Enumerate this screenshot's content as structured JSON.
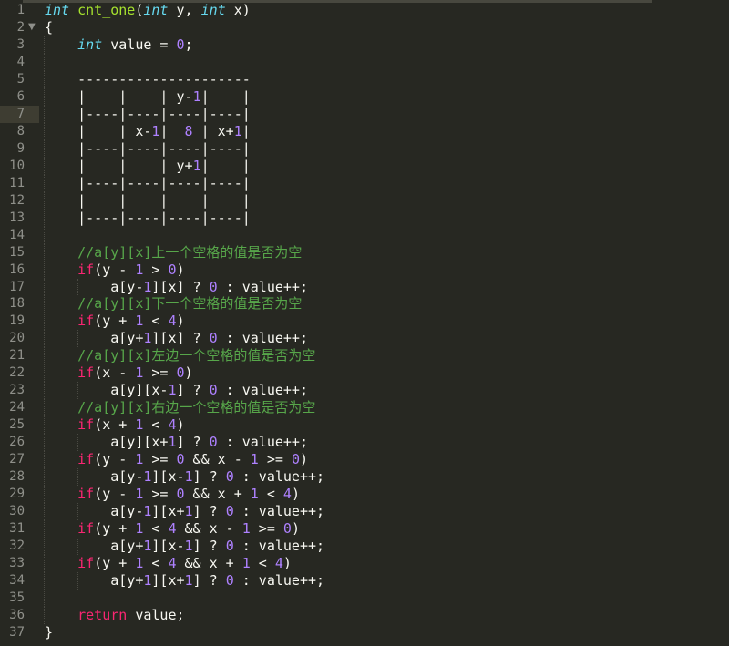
{
  "editor": {
    "theme_colors": {
      "background": "#272822",
      "type": "#66d9ef",
      "function": "#a6e22e",
      "keyword": "#f92672",
      "number": "#ae81ff",
      "comment": "#57a64a",
      "text": "#f8f8f2",
      "line_number": "#8f908a"
    },
    "current_line": 7,
    "folded_marker_line": 2,
    "fold_icon": "triangle-down-icon",
    "lines": [
      {
        "n": "1",
        "tokens": [
          [
            "type",
            "int"
          ],
          [
            "txt",
            " "
          ],
          [
            "fn",
            "cnt_one"
          ],
          [
            "txt",
            "("
          ],
          [
            "type",
            "int"
          ],
          [
            "txt",
            " y, "
          ],
          [
            "type",
            "int"
          ],
          [
            "txt",
            " x)"
          ]
        ]
      },
      {
        "n": "2",
        "tokens": [
          [
            "txt",
            "{"
          ]
        ]
      },
      {
        "n": "3",
        "tokens": [
          [
            "txt",
            "    "
          ],
          [
            "type",
            "int"
          ],
          [
            "txt",
            " value = "
          ],
          [
            "num",
            "0"
          ],
          [
            "txt",
            ";"
          ]
        ]
      },
      {
        "n": "4",
        "tokens": []
      },
      {
        "n": "5",
        "tokens": [
          [
            "txt",
            "    ---------------------"
          ]
        ]
      },
      {
        "n": "6",
        "tokens": [
          [
            "txt",
            "    |    |    | y-"
          ],
          [
            "num",
            "1"
          ],
          [
            "txt",
            "|    |"
          ]
        ]
      },
      {
        "n": "7",
        "tokens": [
          [
            "txt",
            "    |----|----|----|----|"
          ]
        ]
      },
      {
        "n": "8",
        "tokens": [
          [
            "txt",
            "    |    | x-"
          ],
          [
            "num",
            "1"
          ],
          [
            "txt",
            "|  "
          ],
          [
            "num",
            "8"
          ],
          [
            "txt",
            " | x+"
          ],
          [
            "num",
            "1"
          ],
          [
            "txt",
            "|"
          ]
        ]
      },
      {
        "n": "9",
        "tokens": [
          [
            "txt",
            "    |----|----|----|----|"
          ]
        ]
      },
      {
        "n": "10",
        "tokens": [
          [
            "txt",
            "    |    |    | y+"
          ],
          [
            "num",
            "1"
          ],
          [
            "txt",
            "|    |"
          ]
        ]
      },
      {
        "n": "11",
        "tokens": [
          [
            "txt",
            "    |----|----|----|----|"
          ]
        ]
      },
      {
        "n": "12",
        "tokens": [
          [
            "txt",
            "    |    |    |    |    |"
          ]
        ]
      },
      {
        "n": "13",
        "tokens": [
          [
            "txt",
            "    |----|----|----|----|"
          ]
        ]
      },
      {
        "n": "14",
        "tokens": []
      },
      {
        "n": "15",
        "tokens": [
          [
            "txt",
            "    "
          ],
          [
            "cm",
            "//a[y][x]上一个空格的值是否为空"
          ]
        ]
      },
      {
        "n": "16",
        "tokens": [
          [
            "txt",
            "    "
          ],
          [
            "kw",
            "if"
          ],
          [
            "txt",
            "(y - "
          ],
          [
            "num",
            "1"
          ],
          [
            "txt",
            " > "
          ],
          [
            "num",
            "0"
          ],
          [
            "txt",
            ")"
          ]
        ]
      },
      {
        "n": "17",
        "tokens": [
          [
            "txt",
            "        a[y-"
          ],
          [
            "num",
            "1"
          ],
          [
            "txt",
            "][x] ? "
          ],
          [
            "num",
            "0"
          ],
          [
            "txt",
            " : value++;"
          ]
        ]
      },
      {
        "n": "18",
        "tokens": [
          [
            "txt",
            "    "
          ],
          [
            "cm",
            "//a[y][x]下一个空格的值是否为空"
          ]
        ]
      },
      {
        "n": "19",
        "tokens": [
          [
            "txt",
            "    "
          ],
          [
            "kw",
            "if"
          ],
          [
            "txt",
            "(y + "
          ],
          [
            "num",
            "1"
          ],
          [
            "txt",
            " < "
          ],
          [
            "num",
            "4"
          ],
          [
            "txt",
            ")"
          ]
        ]
      },
      {
        "n": "20",
        "tokens": [
          [
            "txt",
            "        a[y+"
          ],
          [
            "num",
            "1"
          ],
          [
            "txt",
            "][x] ? "
          ],
          [
            "num",
            "0"
          ],
          [
            "txt",
            " : value++;"
          ]
        ]
      },
      {
        "n": "21",
        "tokens": [
          [
            "txt",
            "    "
          ],
          [
            "cm",
            "//a[y][x]左边一个空格的值是否为空"
          ]
        ]
      },
      {
        "n": "22",
        "tokens": [
          [
            "txt",
            "    "
          ],
          [
            "kw",
            "if"
          ],
          [
            "txt",
            "(x - "
          ],
          [
            "num",
            "1"
          ],
          [
            "txt",
            " >= "
          ],
          [
            "num",
            "0"
          ],
          [
            "txt",
            ")"
          ]
        ]
      },
      {
        "n": "23",
        "tokens": [
          [
            "txt",
            "        a[y][x-"
          ],
          [
            "num",
            "1"
          ],
          [
            "txt",
            "] ? "
          ],
          [
            "num",
            "0"
          ],
          [
            "txt",
            " : value++;"
          ]
        ]
      },
      {
        "n": "24",
        "tokens": [
          [
            "txt",
            "    "
          ],
          [
            "cm",
            "//a[y][x]右边一个空格的值是否为空"
          ]
        ]
      },
      {
        "n": "25",
        "tokens": [
          [
            "txt",
            "    "
          ],
          [
            "kw",
            "if"
          ],
          [
            "txt",
            "(x + "
          ],
          [
            "num",
            "1"
          ],
          [
            "txt",
            " < "
          ],
          [
            "num",
            "4"
          ],
          [
            "txt",
            ")"
          ]
        ]
      },
      {
        "n": "26",
        "tokens": [
          [
            "txt",
            "        a[y][x+"
          ],
          [
            "num",
            "1"
          ],
          [
            "txt",
            "] ? "
          ],
          [
            "num",
            "0"
          ],
          [
            "txt",
            " : value++;"
          ]
        ]
      },
      {
        "n": "27",
        "tokens": [
          [
            "txt",
            "    "
          ],
          [
            "kw",
            "if"
          ],
          [
            "txt",
            "(y - "
          ],
          [
            "num",
            "1"
          ],
          [
            "txt",
            " >= "
          ],
          [
            "num",
            "0"
          ],
          [
            "txt",
            " && x - "
          ],
          [
            "num",
            "1"
          ],
          [
            "txt",
            " >= "
          ],
          [
            "num",
            "0"
          ],
          [
            "txt",
            ")"
          ]
        ]
      },
      {
        "n": "28",
        "tokens": [
          [
            "txt",
            "        a[y-"
          ],
          [
            "num",
            "1"
          ],
          [
            "txt",
            "][x-"
          ],
          [
            "num",
            "1"
          ],
          [
            "txt",
            "] ? "
          ],
          [
            "num",
            "0"
          ],
          [
            "txt",
            " : value++;"
          ]
        ]
      },
      {
        "n": "29",
        "tokens": [
          [
            "txt",
            "    "
          ],
          [
            "kw",
            "if"
          ],
          [
            "txt",
            "(y - "
          ],
          [
            "num",
            "1"
          ],
          [
            "txt",
            " >= "
          ],
          [
            "num",
            "0"
          ],
          [
            "txt",
            " && x + "
          ],
          [
            "num",
            "1"
          ],
          [
            "txt",
            " < "
          ],
          [
            "num",
            "4"
          ],
          [
            "txt",
            ")"
          ]
        ]
      },
      {
        "n": "30",
        "tokens": [
          [
            "txt",
            "        a[y-"
          ],
          [
            "num",
            "1"
          ],
          [
            "txt",
            "][x+"
          ],
          [
            "num",
            "1"
          ],
          [
            "txt",
            "] ? "
          ],
          [
            "num",
            "0"
          ],
          [
            "txt",
            " : value++;"
          ]
        ]
      },
      {
        "n": "31",
        "tokens": [
          [
            "txt",
            "    "
          ],
          [
            "kw",
            "if"
          ],
          [
            "txt",
            "(y + "
          ],
          [
            "num",
            "1"
          ],
          [
            "txt",
            " < "
          ],
          [
            "num",
            "4"
          ],
          [
            "txt",
            " && x - "
          ],
          [
            "num",
            "1"
          ],
          [
            "txt",
            " >= "
          ],
          [
            "num",
            "0"
          ],
          [
            "txt",
            ")"
          ]
        ]
      },
      {
        "n": "32",
        "tokens": [
          [
            "txt",
            "        a[y+"
          ],
          [
            "num",
            "1"
          ],
          [
            "txt",
            "][x-"
          ],
          [
            "num",
            "1"
          ],
          [
            "txt",
            "] ? "
          ],
          [
            "num",
            "0"
          ],
          [
            "txt",
            " : value++;"
          ]
        ]
      },
      {
        "n": "33",
        "tokens": [
          [
            "txt",
            "    "
          ],
          [
            "kw",
            "if"
          ],
          [
            "txt",
            "(y + "
          ],
          [
            "num",
            "1"
          ],
          [
            "txt",
            " < "
          ],
          [
            "num",
            "4"
          ],
          [
            "txt",
            " && x + "
          ],
          [
            "num",
            "1"
          ],
          [
            "txt",
            " < "
          ],
          [
            "num",
            "4"
          ],
          [
            "txt",
            ")"
          ]
        ]
      },
      {
        "n": "34",
        "tokens": [
          [
            "txt",
            "        a[y+"
          ],
          [
            "num",
            "1"
          ],
          [
            "txt",
            "][x+"
          ],
          [
            "num",
            "1"
          ],
          [
            "txt",
            "] ? "
          ],
          [
            "num",
            "0"
          ],
          [
            "txt",
            " : value++;"
          ]
        ]
      },
      {
        "n": "35",
        "tokens": []
      },
      {
        "n": "36",
        "tokens": [
          [
            "txt",
            "    "
          ],
          [
            "kw",
            "return"
          ],
          [
            "txt",
            " value;"
          ]
        ]
      },
      {
        "n": "37",
        "tokens": [
          [
            "txt",
            "}"
          ]
        ]
      }
    ]
  }
}
